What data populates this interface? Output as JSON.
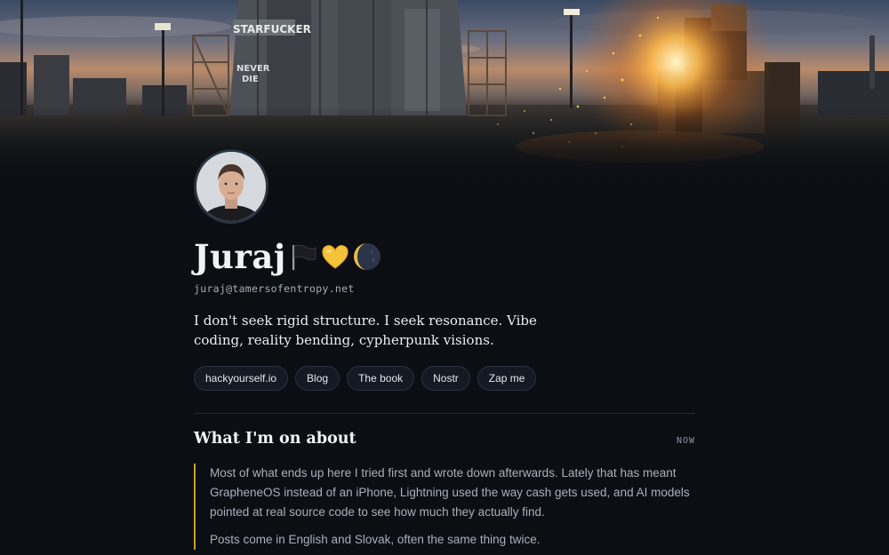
{
  "banner": {
    "image_name": "industrial-workshop-banner",
    "signs": [
      "STARFUCKER",
      "NEVER",
      "DIE"
    ]
  },
  "profile": {
    "avatar_name": "profile-avatar",
    "name": "Juraj",
    "emoji_icons": [
      "black-flag-icon",
      "yellow-heart-icon",
      "crescent-moon-icon"
    ],
    "email": "juraj@tamersofentropy.net",
    "bio": "I don't seek rigid structure. I seek resonance. Vibe coding, reality bending, cypherpunk visions."
  },
  "links": [
    {
      "label": "hackyourself.io"
    },
    {
      "label": "Blog"
    },
    {
      "label": "The book"
    },
    {
      "label": "Nostr"
    },
    {
      "label": "Zap me"
    }
  ],
  "section": {
    "title": "What I'm on about",
    "tag": "NOW",
    "paragraphs": [
      "Most of what ends up here I tried first and wrote down afterwards. Lately that has meant GrapheneOS instead of an iPhone, Lightning used the way cash gets used, and AI models pointed at real source code to see how much they actually find.",
      "Posts come in English and Slovak, often the same thing twice."
    ]
  },
  "colors": {
    "background": "#0b0e13",
    "accent_quote_bar": "#c9a227",
    "pill_border": "#2a3240",
    "text_primary": "#f2f3f5",
    "text_muted": "#a9b0bb"
  }
}
